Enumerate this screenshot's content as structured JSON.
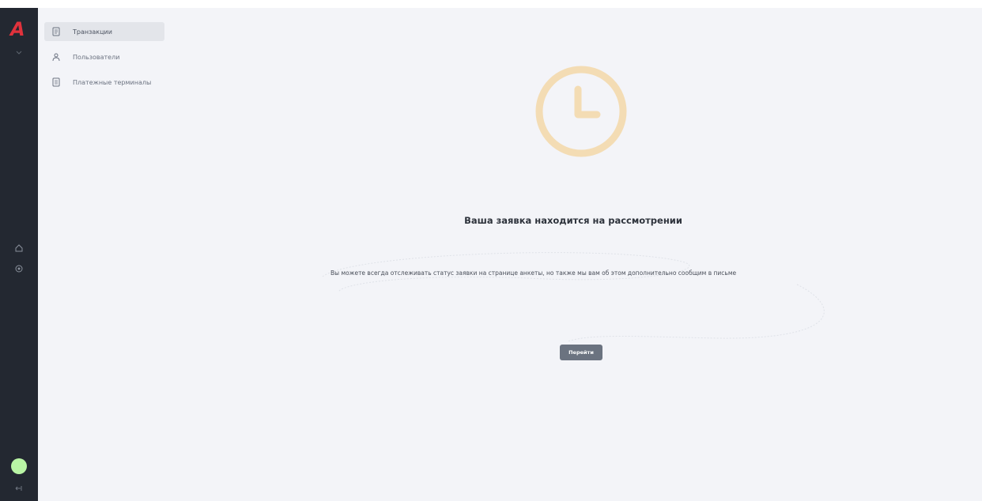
{
  "app": {
    "logo_letter": "A",
    "accent_color": "#e0323c",
    "status_color": "#b9f5a5"
  },
  "sidebar": {
    "items": [
      {
        "label": "Транзакции",
        "icon": "document-icon",
        "active": true
      },
      {
        "label": "Пользователи",
        "icon": "users-icon",
        "active": false
      },
      {
        "label": "Платежные терминалы",
        "icon": "terminal-icon",
        "active": false
      }
    ]
  },
  "rail": {
    "icons": [
      "chevron-down-icon",
      "home-icon",
      "settings-icon",
      "logout-icon"
    ]
  },
  "main": {
    "clock_icon": "clock-icon",
    "clock_color": "#f3dcb4",
    "title": "Ваша заявка находится на рассмотрении",
    "description": "Вы можете всегда отслеживать статус заявки на странице анкеты, но также мы вам об этом дополнительно сообщим в письме",
    "button_label": "Перейти"
  }
}
